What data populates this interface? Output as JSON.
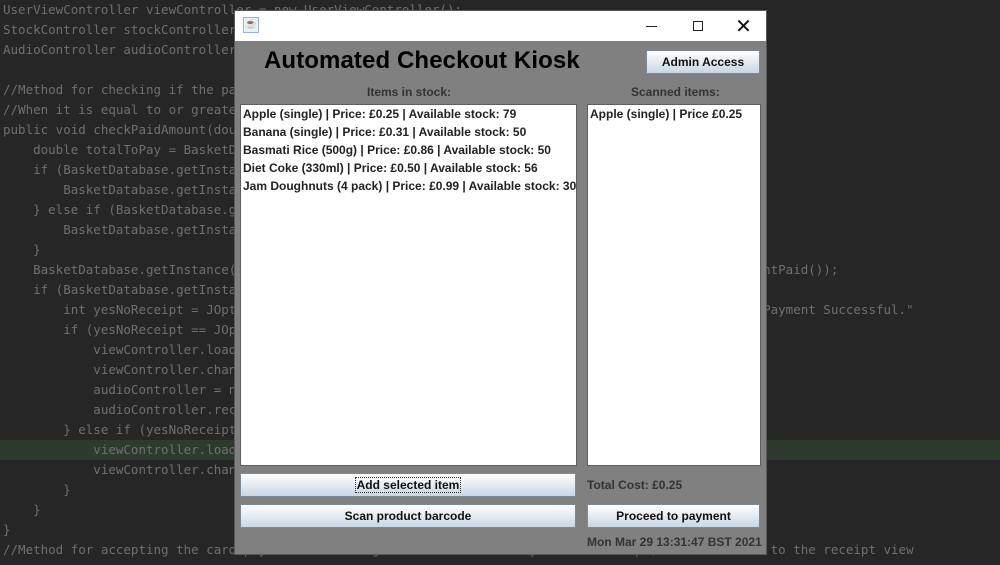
{
  "code_lines": [
    {
      "text": "UserViewController viewController = new UserViewController();",
      "hl": false
    },
    {
      "text": "StockController stockController = new StockController();",
      "hl": false
    },
    {
      "text": "AudioController audioController = new AudioController();",
      "hl": false
    },
    {
      "text": "",
      "hl": false
    },
    {
      "text": "//Method for checking if the paid amount is equal to or greater than the total, accepting input",
      "hl": false
    },
    {
      "text": "//When it is equal to or greater than the total, asks the customer if they would like a receipt",
      "hl": false
    },
    {
      "text": "public void checkPaidAmount(double amountPaid) {",
      "hl": false
    },
    {
      "text": "    double totalToPay = BasketDatabase.getInstance().getTotalCost();",
      "hl": false
    },
    {
      "text": "    if (BasketDatabase.getInstance().getAmountPaid() == 0) {",
      "hl": false
    },
    {
      "text": "        BasketDatabase.getInstance().setAmountPaid(amountPaid);",
      "hl": false
    },
    {
      "text": "    } else if (BasketDatabase.getInstance().getAmountPaid() > 0) {",
      "hl": false
    },
    {
      "text": "        BasketDatabase.getInstance().addAmountPaid(amountPaid);",
      "hl": false
    },
    {
      "text": "    }",
      "hl": false
    },
    {
      "text": "    BasketDatabase.getInstance().setAmountRemaining(totalToPay - BasketDatabase.getInstance().getAmountPaid());",
      "hl": false
    },
    {
      "text": "    if (BasketDatabase.getInstance().getAmountRemaining() <= 0) {",
      "hl": false
    },
    {
      "text": "        int yesNoReceipt = JOptionPane.showConfirmDialog(null, \"Would you like a receipt?\",  title: \"Payment Successful.\"",
      "hl": false
    },
    {
      "text": "        if (yesNoReceipt == JOptionPane.YES_OPTION) {",
      "hl": false
    },
    {
      "text": "            viewController.loadGUI();",
      "hl": false
    },
    {
      "text": "            viewController.changeView();",
      "hl": false
    },
    {
      "text": "            audioController = new AudioController();",
      "hl": false
    },
    {
      "text": "            audioController.receiptSound();",
      "hl": false
    },
    {
      "text": "        } else if (yesNoReceipt == JOptionPane.NO_OPTION) {",
      "hl": false
    },
    {
      "text": "            viewController.loadGUI();",
      "hl": true
    },
    {
      "text": "            viewController.changeView();",
      "hl": false
    },
    {
      "text": "        }",
      "hl": false
    },
    {
      "text": "    }",
      "hl": false
    },
    {
      "text": "}",
      "hl": false
    },
    {
      "text": "//Method for accepting the card payment and asking the customer if they want a receipt, it takes them to the receipt view",
      "hl": false
    }
  ],
  "window": {
    "app_title": "Automated Checkout Kiosk",
    "admin_button": "Admin Access",
    "stock_label": "Items in stock:",
    "scanned_label": "Scanned items:",
    "stock_items": [
      "Apple (single) | Price: £0.25 | Available stock: 79",
      "Banana (single) | Price: £0.31 | Available stock: 50",
      "Basmati Rice (500g) | Price: £0.86 | Available stock: 50",
      "Diet Coke (330ml) | Price: £0.50 | Available stock: 56",
      "Jam Doughnuts (4 pack) | Price: £0.99 | Available stock: 30"
    ],
    "scanned_items": [
      "Apple (single) | Price £0.25"
    ],
    "add_button": "Add selected item",
    "scan_button": "Scan product barcode",
    "total_cost": "Total Cost: £0.25",
    "pay_button": "Proceed to payment",
    "datetime": "Mon Mar 29 13:31:47 BST 2021"
  },
  "icons": {
    "window_icon": "java-icon",
    "minimize": "minimize-icon",
    "maximize": "maximize-icon",
    "close": "close-icon"
  }
}
